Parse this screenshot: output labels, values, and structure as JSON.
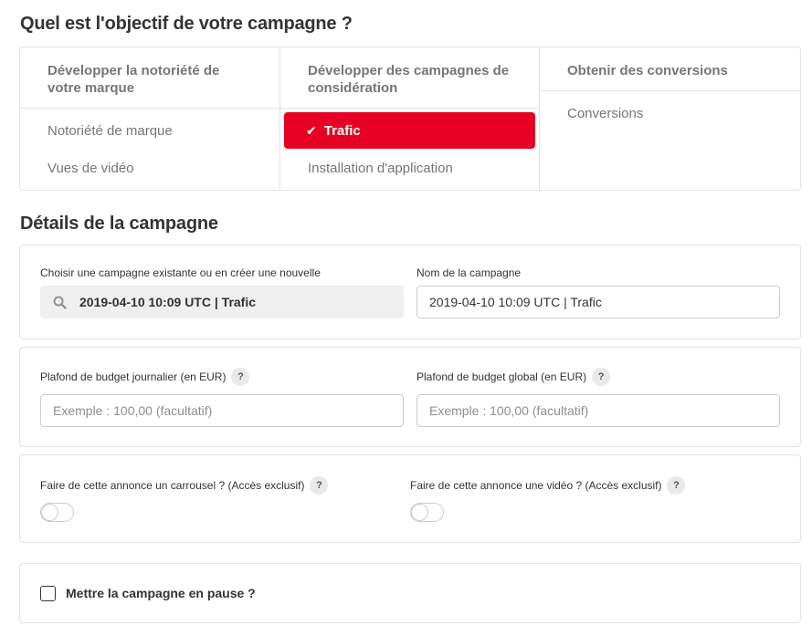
{
  "objective": {
    "title": "Quel est l'objectif de votre campagne ?",
    "columns": [
      {
        "heading": "Développer la notoriété de votre marque",
        "options": [
          "Notoriété de marque",
          "Vues de vidéo"
        ]
      },
      {
        "heading": "Développer des campagnes de considération",
        "selected": "Trafic",
        "options": [
          "Installation d'application"
        ]
      },
      {
        "heading": "Obtenir des conversions",
        "options": [
          "Conversions"
        ]
      }
    ],
    "selected_check": "✔",
    "accent_color": "#e60023"
  },
  "details": {
    "title": "Détails de la campagne",
    "existing_label": "Choisir une campagne existante ou en créer une nouvelle",
    "existing_value": "2019-04-10 10:09 UTC | Trafic",
    "name_label": "Nom de la campagne",
    "name_value": "2019-04-10 10:09 UTC | Trafic",
    "daily_budget_label": "Plafond de budget journalier (en EUR)",
    "daily_budget_placeholder": "Exemple : 100,00 (facultatif)",
    "global_budget_label": "Plafond de budget global (en EUR)",
    "global_budget_placeholder": "Exemple : 100,00 (facultatif)",
    "carousel_label": "Faire de cette annonce un carrousel ? (Accès exclusif)",
    "video_label": "Faire de cette annonce une vidéo ? (Accès exclusif)",
    "help": "?",
    "pause_label": "Mettre la campagne en pause ?"
  }
}
